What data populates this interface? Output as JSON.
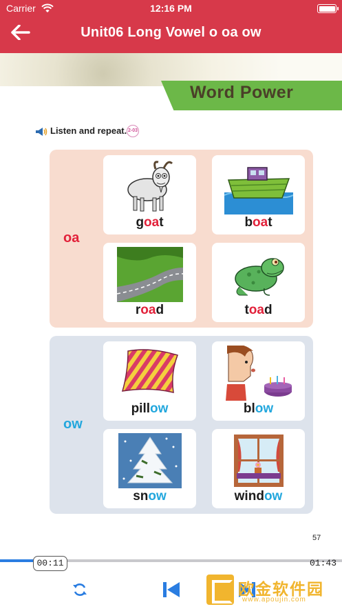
{
  "status_bar": {
    "carrier": "Carrier",
    "time": "12:16 PM"
  },
  "nav": {
    "title": "Unit06 Long Vowel o oa ow"
  },
  "book": {
    "banner": "Word Power",
    "instruction": "Listen and repeat.",
    "track": "2-03",
    "page_number": "57",
    "groups": [
      {
        "label": "oa",
        "words": [
          {
            "pre": "g",
            "hl": "oa",
            "post": "t",
            "image": "goat-picture"
          },
          {
            "pre": "b",
            "hl": "oa",
            "post": "t",
            "image": "boat-picture"
          },
          {
            "pre": "r",
            "hl": "oa",
            "post": "d",
            "image": "road-picture"
          },
          {
            "pre": "t",
            "hl": "oa",
            "post": "d",
            "image": "toad-picture"
          }
        ]
      },
      {
        "label": "ow",
        "words": [
          {
            "pre": "pill",
            "hl": "ow",
            "post": "",
            "image": "pillow-picture"
          },
          {
            "pre": "bl",
            "hl": "ow",
            "post": "",
            "image": "blow-picture"
          },
          {
            "pre": "sn",
            "hl": "ow",
            "post": "",
            "image": "snow-picture"
          },
          {
            "pre": "wind",
            "hl": "ow",
            "post": "",
            "image": "window-picture"
          }
        ]
      }
    ]
  },
  "player": {
    "current_time": "00:11",
    "total_time": "01:43",
    "progress": 0.107,
    "controls": [
      "repeat-icon",
      "previous-track-icon",
      "next-track-icon"
    ]
  },
  "watermark": {
    "text": "欧金软件园",
    "url": "www.apoujin.com"
  },
  "colors": {
    "nav_red": "#d7394a",
    "oa_red": "#e2213a",
    "ow_blue": "#23a7dd",
    "progress_blue": "#2a7de1",
    "banner_green": "#6cb848"
  }
}
